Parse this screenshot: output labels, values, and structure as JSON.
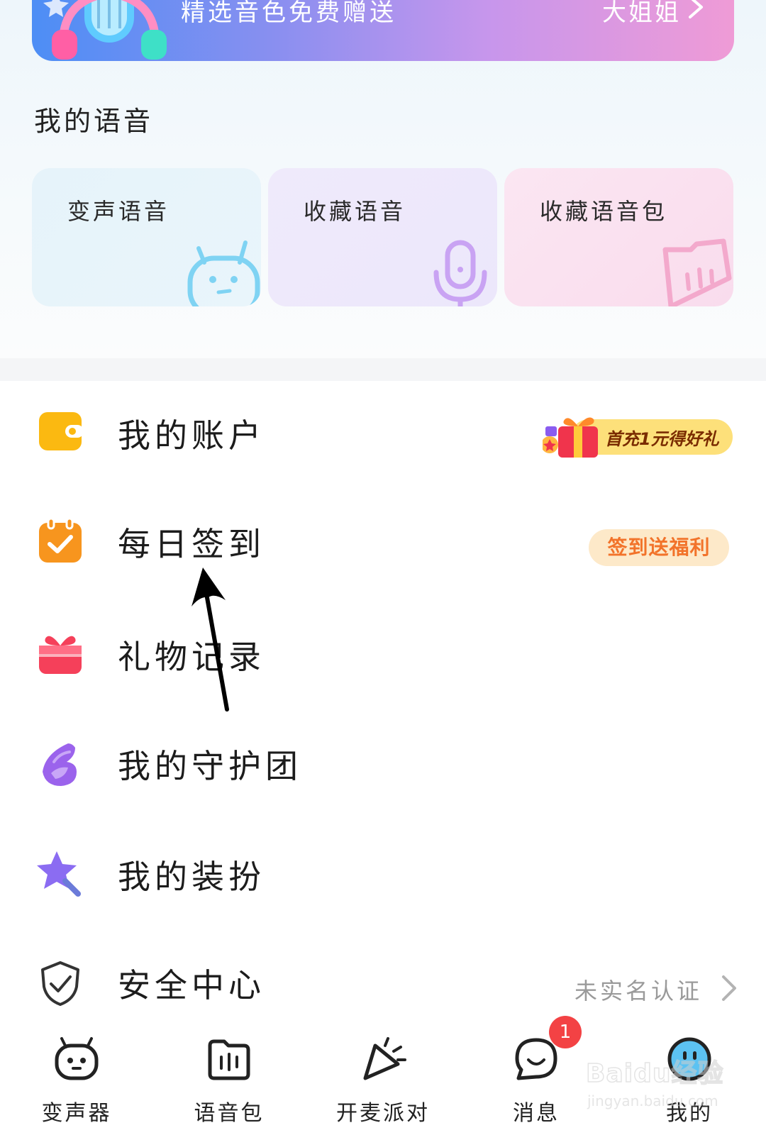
{
  "banner": {
    "text": "精选音色免费赠送",
    "voice": "大姐姐"
  },
  "my_voice": {
    "title": "我的语音",
    "cards": [
      {
        "label": "变声语音",
        "icon": "robot-face-icon"
      },
      {
        "label": "收藏语音",
        "icon": "microphone-icon"
      },
      {
        "label": "收藏语音包",
        "icon": "folder-waveform-icon"
      }
    ]
  },
  "menu": [
    {
      "label": "我的账户",
      "icon": "wallet-icon",
      "badge": "首充1元得好礼"
    },
    {
      "label": "每日签到",
      "icon": "calendar-check-icon",
      "badge": "签到送福利"
    },
    {
      "label": "礼物记录",
      "icon": "gift-box-icon"
    },
    {
      "label": "我的守护团",
      "icon": "wing-icon"
    },
    {
      "label": "我的装扮",
      "icon": "magic-wand-star-icon"
    },
    {
      "label": "安全中心",
      "icon": "shield-check-icon",
      "status": "未实名认证"
    }
  ],
  "bottom_nav": [
    {
      "label": "变声器",
      "icon": "robot-face-icon"
    },
    {
      "label": "语音包",
      "icon": "folder-waveform-icon"
    },
    {
      "label": "开麦派对",
      "icon": "party-popper-icon"
    },
    {
      "label": "消息",
      "icon": "chat-bubble-icon",
      "badge": "1"
    },
    {
      "label": "我的",
      "icon": "avatar-face-icon"
    }
  ],
  "watermark": {
    "main": "Baidu经验",
    "sub": "jingyan.baidu.com"
  },
  "colors": {
    "accent_orange": "#f2732a",
    "badge_red": "#f34244",
    "wallet_yellow": "#fbb911",
    "gift_red": "#f5405a",
    "wing_purple": "#9b63ec"
  }
}
